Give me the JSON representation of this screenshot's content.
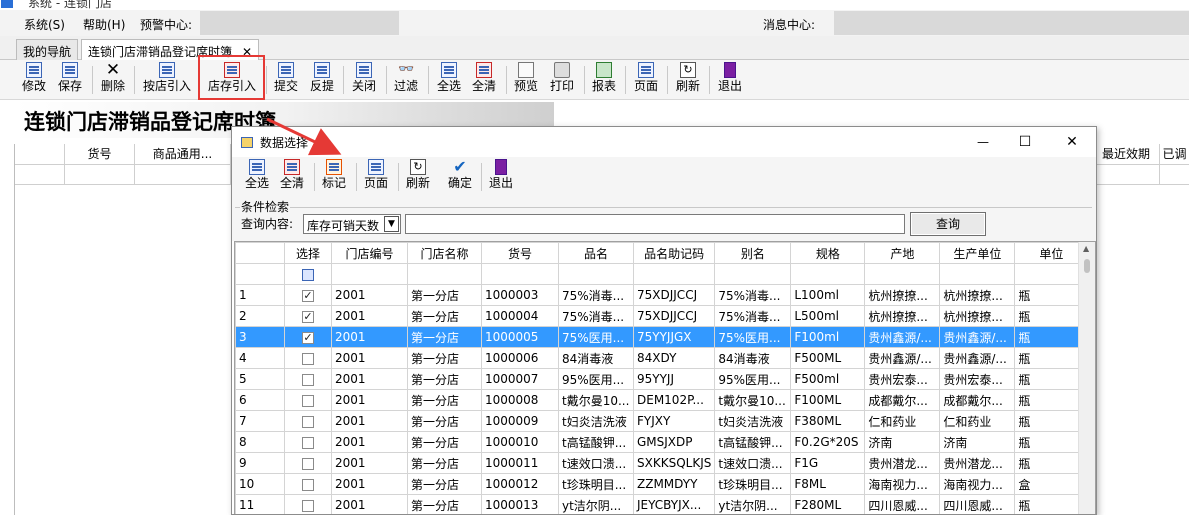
{
  "app": {
    "title": "系统 - 连锁门店"
  },
  "menubar": {
    "items": [
      "系统(S)",
      "帮助(H)",
      "预警中心:"
    ],
    "message_center": "消息中心:"
  },
  "tabs": [
    {
      "label": "我的导航"
    },
    {
      "label": "连锁门店滞销品登记席时簿",
      "close": "✕"
    }
  ],
  "toolbar": {
    "buttons": [
      "修改",
      "保存",
      "删除",
      "按店引入",
      "店存引入",
      "提交",
      "反提",
      "关闭",
      "过滤",
      "全选",
      "全清",
      "预览",
      "打印",
      "报表",
      "页面",
      "刷新",
      "退出"
    ],
    "highlight_color": "#e53935"
  },
  "page": {
    "title": "连锁门店滞销品登记席时簿"
  },
  "background_grid": {
    "columns": [
      "货号",
      "商品通用...",
      "最近效期",
      "已调"
    ]
  },
  "dialog": {
    "title": "数据选择",
    "window_buttons": {
      "minimize": "—",
      "maximize": "☐",
      "close": "✕"
    },
    "toolbar": [
      "全选",
      "全清",
      "标记",
      "页面",
      "刷新",
      "确定",
      "退出"
    ],
    "condition": {
      "legend": "条件检索",
      "label": "查询内容:",
      "select_value": "库存可销天数",
      "input_value": "",
      "search_button": "查询"
    },
    "table": {
      "columns": [
        "",
        "选择",
        "门店编号",
        "门店名称",
        "货号",
        "品名",
        "品名助记码",
        "别名",
        "规格",
        "产地",
        "生产单位",
        "单位"
      ],
      "selected_row_color": "#3399ff",
      "rows": [
        {
          "n": "1",
          "checked": true,
          "store_no": "2001",
          "store": "第一分店",
          "code": "1000003",
          "name": "75%消毒...",
          "mnemonic": "75XDJJCCJ",
          "alias": "75%消毒...",
          "spec": "L100ml",
          "origin": "杭州撩撩...",
          "maker": "杭州撩撩...",
          "unit": "瓶"
        },
        {
          "n": "2",
          "checked": true,
          "store_no": "2001",
          "store": "第一分店",
          "code": "1000004",
          "name": "75%消毒...",
          "mnemonic": "75XDJJCCJ",
          "alias": "75%消毒...",
          "spec": "L500ml",
          "origin": "杭州撩撩...",
          "maker": "杭州撩撩...",
          "unit": "瓶"
        },
        {
          "n": "3",
          "checked": true,
          "store_no": "2001",
          "store": "第一分店",
          "code": "1000005",
          "name": "75%医用...",
          "mnemonic": "75YYJJGX",
          "alias": "75%医用...",
          "spec": "F100ml",
          "origin": "贵州鑫源/...",
          "maker": "贵州鑫源/...",
          "unit": "瓶",
          "selected": true
        },
        {
          "n": "4",
          "checked": false,
          "store_no": "2001",
          "store": "第一分店",
          "code": "1000006",
          "name": "84消毒液",
          "mnemonic": "84XDY",
          "alias": "84消毒液",
          "spec": "F500ML",
          "origin": "贵州鑫源/...",
          "maker": "贵州鑫源/...",
          "unit": "瓶"
        },
        {
          "n": "5",
          "checked": false,
          "store_no": "2001",
          "store": "第一分店",
          "code": "1000007",
          "name": "95%医用...",
          "mnemonic": "95YYJJ",
          "alias": "95%医用...",
          "spec": "F500ml",
          "origin": "贵州宏泰...",
          "maker": "贵州宏泰...",
          "unit": "瓶"
        },
        {
          "n": "6",
          "checked": false,
          "store_no": "2001",
          "store": "第一分店",
          "code": "1000008",
          "name": "t戴尔曼10...",
          "mnemonic": "DEM102P...",
          "alias": "t戴尔曼10...",
          "spec": "F100ML",
          "origin": "成都戴尔...",
          "maker": "成都戴尔...",
          "unit": "瓶"
        },
        {
          "n": "7",
          "checked": false,
          "store_no": "2001",
          "store": "第一分店",
          "code": "1000009",
          "name": "t妇炎洁洗液",
          "mnemonic": "FYJXY",
          "alias": "t妇炎洁洗液",
          "spec": "F380ML",
          "origin": "仁和药业",
          "maker": "仁和药业",
          "unit": "瓶"
        },
        {
          "n": "8",
          "checked": false,
          "store_no": "2001",
          "store": "第一分店",
          "code": "1000010",
          "name": "t高锰酸钾...",
          "mnemonic": "GMSJXDP",
          "alias": "t高锰酸钾...",
          "spec": "F0.2G*20S",
          "origin": "济南",
          "maker": "济南",
          "unit": "瓶"
        },
        {
          "n": "9",
          "checked": false,
          "store_no": "2001",
          "store": "第一分店",
          "code": "1000011",
          "name": "t速效口溃...",
          "mnemonic": "SXKKSQLKJS",
          "alias": "t速效口溃...",
          "spec": "F1G",
          "origin": "贵州潜龙...",
          "maker": "贵州潜龙...",
          "unit": "瓶"
        },
        {
          "n": "10",
          "checked": false,
          "store_no": "2001",
          "store": "第一分店",
          "code": "1000012",
          "name": "t珍珠明目...",
          "mnemonic": "ZZMMDYY",
          "alias": "t珍珠明目...",
          "spec": "F8ML",
          "origin": "海南视力...",
          "maker": "海南视力...",
          "unit": "盒"
        },
        {
          "n": "11",
          "checked": false,
          "store_no": "2001",
          "store": "第一分店",
          "code": "1000013",
          "name": "yt洁尔阴...",
          "mnemonic": "JEYCBYJX...",
          "alias": "yt洁尔阴...",
          "spec": "F280ML",
          "origin": "四川恩威...",
          "maker": "四川恩威...",
          "unit": "瓶"
        }
      ]
    }
  }
}
